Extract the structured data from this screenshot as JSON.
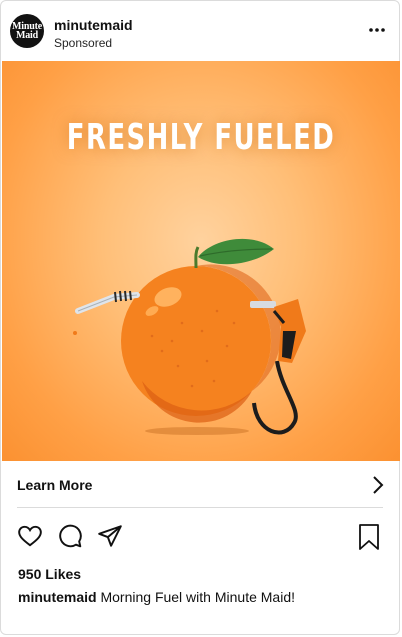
{
  "post": {
    "account": {
      "username": "minutemaid",
      "subtitle": "Sponsored",
      "avatar_text_line1": "Minute",
      "avatar_text_line2": "Maid",
      "avatar_color": "#121212"
    },
    "ad": {
      "headline": "FRESHLY FUELED",
      "background_color": "#ffa046",
      "icons": [
        "orange-icon",
        "leaf-icon",
        "straw-icon",
        "fuel-nozzle-icon"
      ]
    },
    "cta": {
      "label": "Learn More",
      "icon": "chevron-right-icon"
    },
    "actions": [
      "heart-icon",
      "comment-icon",
      "share-icon",
      "bookmark-icon"
    ],
    "likes": "950 Likes",
    "caption": {
      "username": "minutemaid",
      "text": "Morning Fuel with Minute Maid!"
    }
  }
}
